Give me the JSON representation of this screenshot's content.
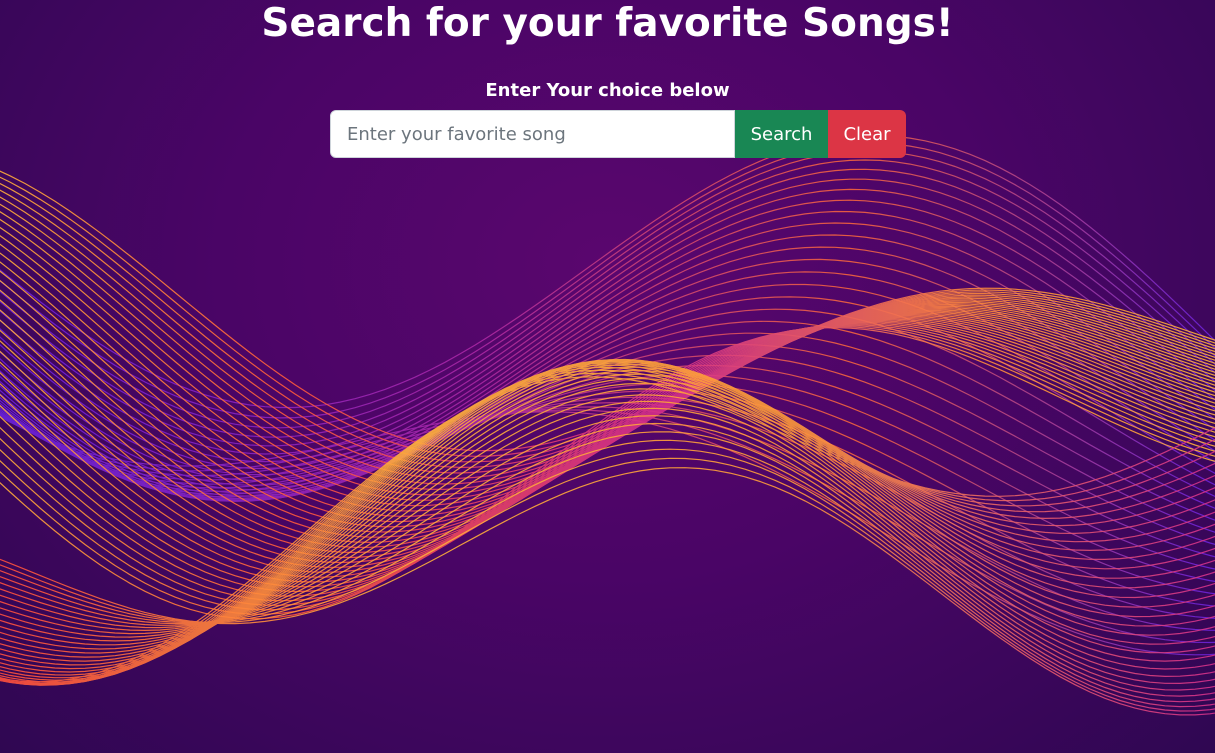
{
  "page": {
    "title": "Search for your favorite Songs!",
    "subtitle": "Enter Your choice below"
  },
  "search": {
    "placeholder": "Enter your favorite song",
    "value": "",
    "search_label": "Search",
    "clear_label": "Clear"
  },
  "colors": {
    "background": "#4a0566",
    "search_button": "#198754",
    "clear_button": "#dc3545",
    "wave_gradient": [
      "#6a22e8",
      "#d42e8e",
      "#ff4a3d",
      "#ffb23a"
    ]
  }
}
